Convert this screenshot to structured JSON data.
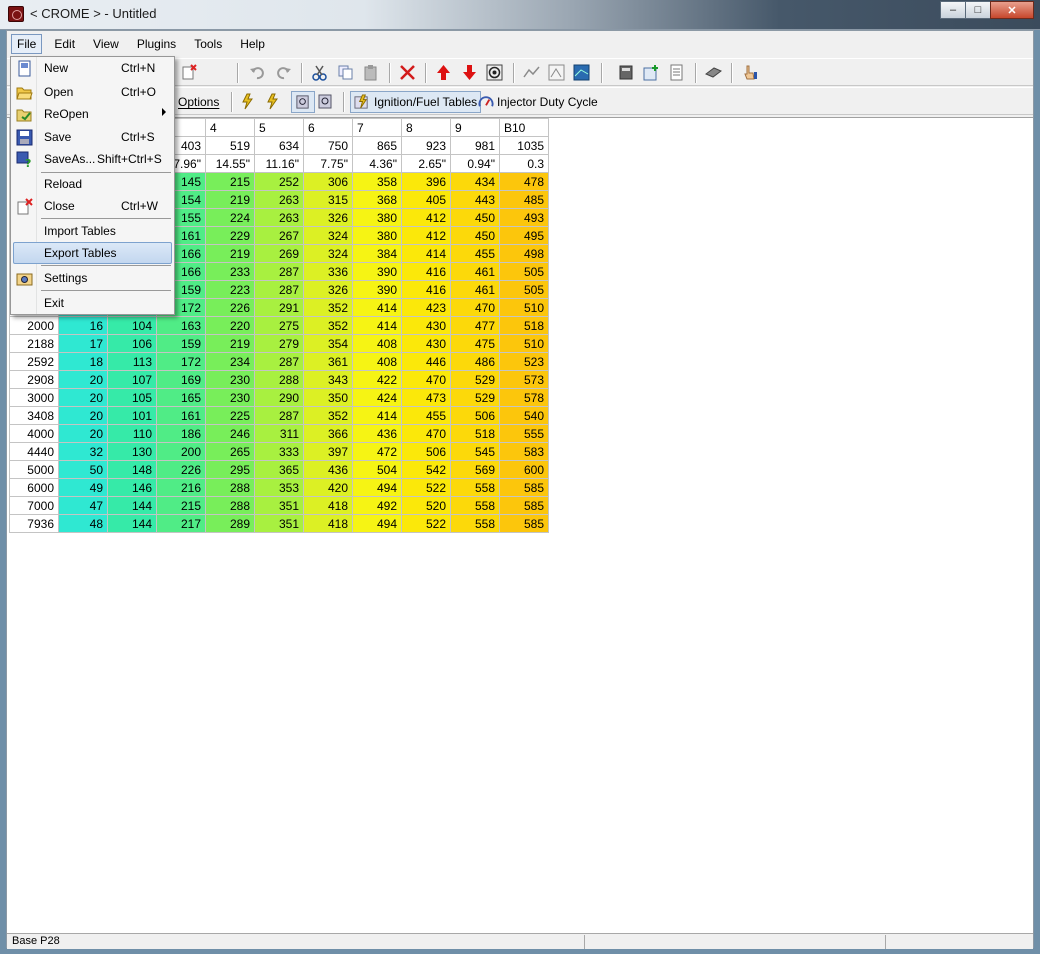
{
  "window": {
    "title": "< CROME > - Untitled"
  },
  "menubar": [
    "File",
    "Edit",
    "View",
    "Plugins",
    "Tools",
    "Help"
  ],
  "toolbar2": {
    "options_label": "Options",
    "ignition_tab": "Ignition/Fuel Tables",
    "injector_tab": "Injector Duty Cycle"
  },
  "file_menu": {
    "items": [
      {
        "label": "New",
        "shortcut": "Ctrl+N",
        "icon": "new-file-icon"
      },
      {
        "label": "Open",
        "shortcut": "Ctrl+O",
        "icon": "open-folder-icon"
      },
      {
        "label": "ReOpen",
        "shortcut": "",
        "icon": "reopen-folder-icon"
      },
      {
        "label": "Save",
        "shortcut": "Ctrl+S",
        "icon": "save-disk-icon"
      },
      {
        "label": "SaveAs...",
        "shortcut": "Shift+Ctrl+S",
        "icon": "save-as-icon"
      },
      {
        "label": "Reload",
        "shortcut": "",
        "icon": ""
      },
      {
        "label": "Close",
        "shortcut": "Ctrl+W",
        "icon": "close-file-icon"
      },
      {
        "label": "Import Tables",
        "shortcut": "",
        "icon": ""
      },
      {
        "label": "Export Tables",
        "shortcut": "",
        "icon": ""
      },
      {
        "label": "Settings",
        "shortcut": "",
        "icon": "settings-icon"
      },
      {
        "label": "Exit",
        "shortcut": "",
        "icon": ""
      }
    ],
    "selected": "Export Tables"
  },
  "table": {
    "col_headers": [
      "",
      "",
      "",
      "",
      "4",
      "5",
      "6",
      "7",
      "8",
      "9",
      "B10"
    ],
    "map_row": [
      "",
      "",
      "",
      "403",
      "519",
      "634",
      "750",
      "865",
      "923",
      "981",
      "1035"
    ],
    "vac_row": [
      "",
      "",
      "",
      "7.96\"",
      "14.55\"",
      "11.16\"",
      "7.75\"",
      "4.36\"",
      "2.65\"",
      "0.94\"",
      "0.3"
    ],
    "rows": [
      {
        "rpm": "",
        "v": [
          "",
          "",
          "145",
          "215",
          "252",
          "306",
          "358",
          "396",
          "434",
          "478"
        ]
      },
      {
        "rpm": "",
        "v": [
          "",
          "",
          "154",
          "219",
          "263",
          "315",
          "368",
          "405",
          "443",
          "485"
        ]
      },
      {
        "rpm": "",
        "v": [
          "",
          "",
          "155",
          "224",
          "263",
          "326",
          "380",
          "412",
          "450",
          "493"
        ]
      },
      {
        "rpm": "",
        "v": [
          "",
          "",
          "161",
          "229",
          "267",
          "324",
          "380",
          "412",
          "450",
          "495"
        ]
      },
      {
        "rpm": "",
        "v": [
          "",
          "",
          "166",
          "219",
          "269",
          "324",
          "384",
          "414",
          "455",
          "498"
        ]
      },
      {
        "rpm": "",
        "v": [
          "",
          "",
          "166",
          "233",
          "287",
          "336",
          "390",
          "416",
          "461",
          "505"
        ]
      },
      {
        "rpm": "",
        "v": [
          "",
          "",
          "159",
          "223",
          "287",
          "326",
          "390",
          "416",
          "461",
          "505"
        ]
      },
      {
        "rpm": "",
        "v": [
          "",
          "",
          "172",
          "226",
          "291",
          "352",
          "414",
          "423",
          "470",
          "510"
        ]
      },
      {
        "rpm": "2000",
        "v": [
          "16",
          "104",
          "163",
          "220",
          "275",
          "352",
          "414",
          "430",
          "477",
          "518"
        ]
      },
      {
        "rpm": "2188",
        "v": [
          "17",
          "106",
          "159",
          "219",
          "279",
          "354",
          "408",
          "430",
          "475",
          "510"
        ]
      },
      {
        "rpm": "2592",
        "v": [
          "18",
          "113",
          "172",
          "234",
          "287",
          "361",
          "408",
          "446",
          "486",
          "523"
        ]
      },
      {
        "rpm": "2908",
        "v": [
          "20",
          "107",
          "169",
          "230",
          "288",
          "343",
          "422",
          "470",
          "529",
          "573"
        ]
      },
      {
        "rpm": "3000",
        "v": [
          "20",
          "105",
          "165",
          "230",
          "290",
          "350",
          "424",
          "473",
          "529",
          "578"
        ]
      },
      {
        "rpm": "3408",
        "v": [
          "20",
          "101",
          "161",
          "225",
          "287",
          "352",
          "414",
          "455",
          "506",
          "540"
        ]
      },
      {
        "rpm": "4000",
        "v": [
          "20",
          "110",
          "186",
          "246",
          "311",
          "366",
          "436",
          "470",
          "518",
          "555"
        ]
      },
      {
        "rpm": "4440",
        "v": [
          "32",
          "130",
          "200",
          "265",
          "333",
          "397",
          "472",
          "506",
          "545",
          "583"
        ]
      },
      {
        "rpm": "5000",
        "v": [
          "50",
          "148",
          "226",
          "295",
          "365",
          "436",
          "504",
          "542",
          "569",
          "600"
        ]
      },
      {
        "rpm": "6000",
        "v": [
          "49",
          "146",
          "216",
          "288",
          "353",
          "420",
          "494",
          "522",
          "558",
          "585"
        ]
      },
      {
        "rpm": "7000",
        "v": [
          "47",
          "144",
          "215",
          "288",
          "351",
          "418",
          "492",
          "520",
          "558",
          "585"
        ]
      },
      {
        "rpm": "7936",
        "v": [
          "48",
          "144",
          "217",
          "289",
          "351",
          "418",
          "494",
          "522",
          "558",
          "585"
        ]
      }
    ]
  },
  "colors": [
    "#2fe8d2",
    "#36eaa8",
    "#50ec86",
    "#78ee5a",
    "#a8f040",
    "#dcf024",
    "#f6f414",
    "#fbe80a",
    "#fcd90a",
    "#fcc60c"
  ],
  "statusbar": {
    "left": "Base P28"
  }
}
